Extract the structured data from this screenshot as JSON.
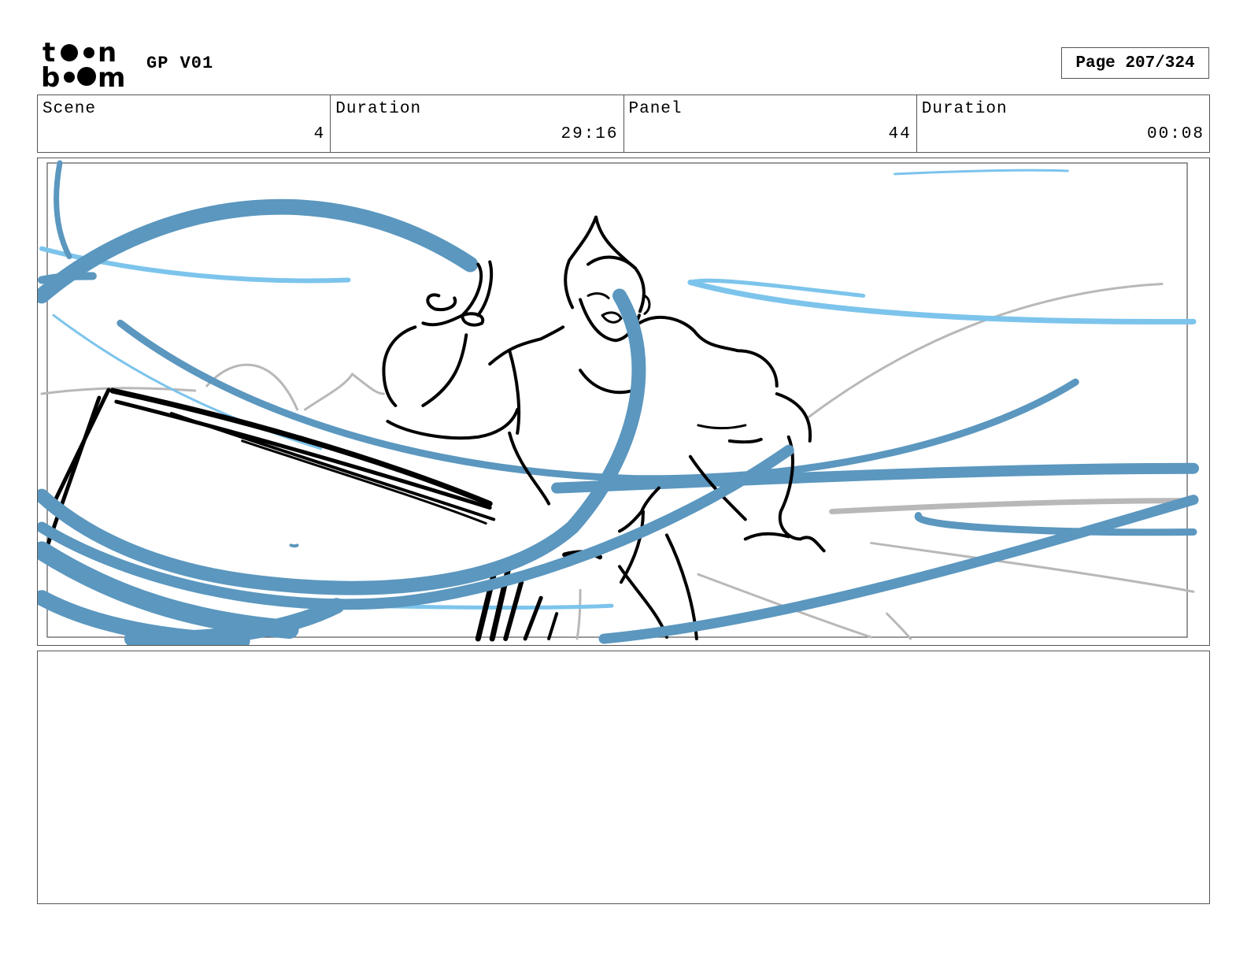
{
  "header": {
    "logo_lines": [
      "toon",
      "boom"
    ],
    "project_title": "GP V01",
    "page_label": "Page 207/324"
  },
  "info": {
    "scene_label": "Scene",
    "scene_value": "4",
    "scene_duration_label": "Duration",
    "scene_duration_value": "29:16",
    "panel_label": "Panel",
    "panel_value": "44",
    "panel_duration_label": "Duration",
    "panel_duration_value": "00:08"
  },
  "notes": {
    "text": ""
  },
  "colors": {
    "swirl_dark": "#5b97bf",
    "swirl_light": "#7cc4ec",
    "sketch_line": "#000000",
    "background_line": "#b8b8b8"
  }
}
